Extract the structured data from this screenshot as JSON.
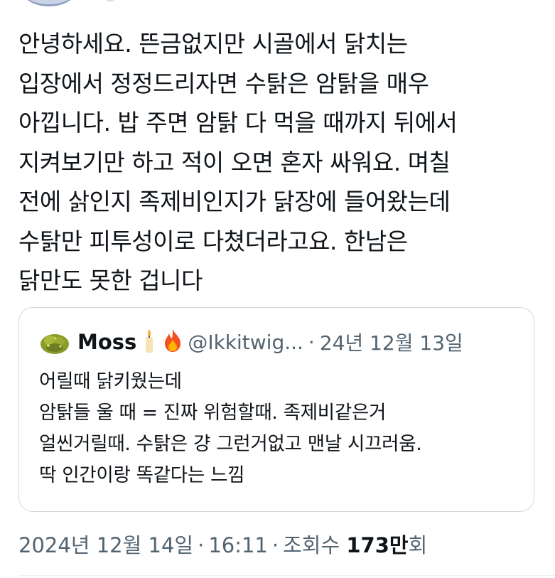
{
  "tweet": {
    "text": "안녕하세요. 뜬금없지만 시골에서 닭치는\n입장에서 정정드리자면 수탉은 암탉을 매우\n아낍니다. 밥 주면 암탉 다 먹을 때까지 뒤에서\n지켜보기만 하고 적이 오면 혼자 싸워요. 며칠\n전에 삵인지 족제비인지가 닭장에 들어왔는데\n수탉만 피투성이로 다쳤더라고요. 한남은\n닭만도 못한 겁니다"
  },
  "quote": {
    "name": "Moss",
    "emoji_candle": "🕯",
    "emoji_fire": "🔥",
    "handle": "@Ikkitwig...",
    "separator": "·",
    "date": "24년 12월 13일",
    "text": "어릴때 닭키웠는데\n암탉들 울 때 = 진짜 위험할때. 족제비같은거\n얼씬거릴때. 수탉은 걍 그런거없고 맨날 시끄러움.\n딱 인간이랑 똑같다는 느낌"
  },
  "meta": {
    "date": "2024년 12월 14일",
    "sep1": "·",
    "time": "16:11",
    "sep2": "·",
    "views_label": "조회수",
    "views_count": "173만",
    "views_suffix": "회"
  },
  "icons": {
    "quote_avatar": "moss-ball-avatar",
    "candle": "candle-emoji",
    "fire": "fire-emoji"
  }
}
